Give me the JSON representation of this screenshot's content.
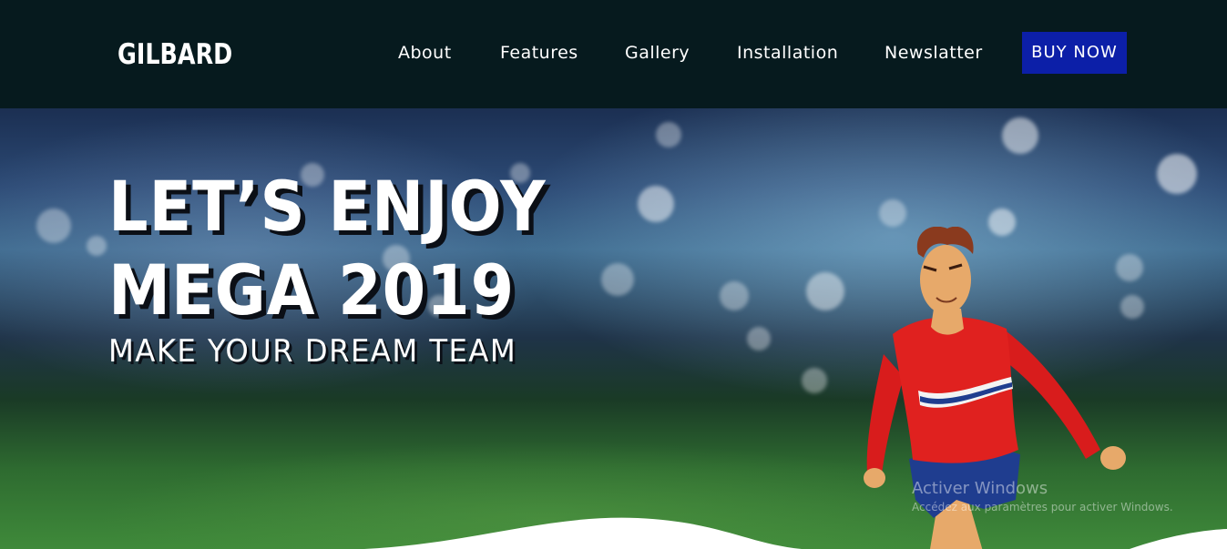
{
  "navbar": {
    "logo": "GILBARD",
    "links": [
      {
        "label": "About"
      },
      {
        "label": "Features"
      },
      {
        "label": "Gallery"
      },
      {
        "label": "Installation"
      },
      {
        "label": "Newslatter"
      }
    ],
    "cta_label": "BUY NOW"
  },
  "hero": {
    "headline_line1": "LET’S ENJOY",
    "headline_line2": "MEGA 2019",
    "tagline": "MAKE YOUR DREAM TEAM"
  },
  "watermark": {
    "title": "Activer Windows",
    "subtitle": "Accédez aux paramètres pour activer Windows."
  },
  "colors": {
    "navbar_bg": "#061a1e",
    "cta_bg": "#0c1fa8",
    "jersey_red": "#e0211f",
    "shorts_blue": "#1f3d8f"
  },
  "icons": {
    "illustration": "soccer-player-illustration"
  }
}
